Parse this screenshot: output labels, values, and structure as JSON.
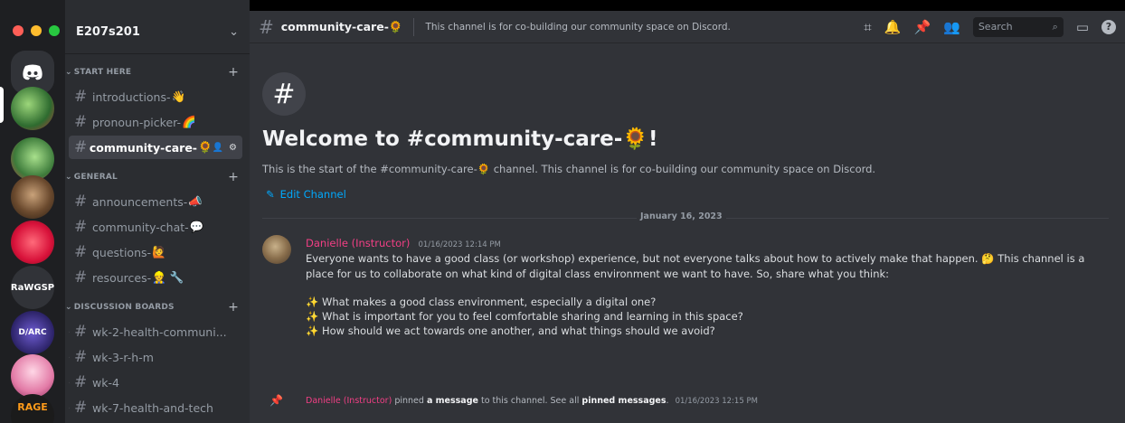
{
  "window": {
    "lights": [
      "#ff5f57",
      "#febc2e",
      "#28c840"
    ]
  },
  "servers": [
    {
      "name": "home",
      "icon": "discord-logo-icon"
    },
    {
      "name": "server-1",
      "label": ""
    },
    {
      "name": "server-2",
      "label": ""
    },
    {
      "name": "server-3",
      "label": ""
    },
    {
      "name": "server-4",
      "label": ""
    },
    {
      "name": "server-rawgsp",
      "label": "RaWGSP"
    },
    {
      "name": "server-diarc",
      "label": "D/ARC"
    },
    {
      "name": "server-6",
      "label": ""
    },
    {
      "name": "server-rage",
      "label": "RAGE"
    }
  ],
  "sidebar": {
    "server_name": "E207s201",
    "categories": [
      {
        "label": "START HERE",
        "channels": [
          {
            "name": "introductions-",
            "emoji": "👋"
          },
          {
            "name": "pronoun-picker-",
            "emoji": "🌈"
          },
          {
            "name": "community-care-",
            "emoji": "🌻",
            "active": true
          }
        ]
      },
      {
        "label": "GENERAL",
        "channels": [
          {
            "name": "announcements-",
            "emoji": "📣"
          },
          {
            "name": "community-chat-",
            "emoji": "💬"
          },
          {
            "name": "questions-",
            "emoji": "🙋"
          },
          {
            "name": "resources-",
            "emoji": "👷 🔧"
          }
        ]
      },
      {
        "label": "DISCUSSION BOARDS",
        "channels": [
          {
            "name": "wk-2-health-communi...",
            "emoji": ""
          },
          {
            "name": "wk-3-r-h-m",
            "emoji": ""
          },
          {
            "name": "wk-4",
            "emoji": ""
          },
          {
            "name": "wk-7-health-and-tech",
            "emoji": ""
          }
        ]
      }
    ]
  },
  "topbar": {
    "channel_name": "community-care-",
    "channel_emoji": "🌻",
    "topic": "This channel is for co-building our community space on Discord.",
    "search_placeholder": "Search"
  },
  "intro": {
    "title": "Welcome to #community-care-",
    "title_emoji": "🌻",
    "title_end": "!",
    "start_note_a": "This is the start of the #community-care-",
    "start_note_emoji": "🌻",
    "start_note_b": " channel. This channel is for co-building our community space on Discord.",
    "edit_label": "Edit Channel"
  },
  "divider_date": "January 16, 2023",
  "message": {
    "author": "Danielle (Instructor)",
    "timestamp": "01/16/2023 12:14 PM",
    "text_a": "Everyone wants to have a good class (or workshop) experience, but not everyone talks about how to actively make that happen. ",
    "text_emoji": "🤔",
    "text_b": " This channel is a place for us to collaborate on what kind of digital class environment we want to have. So, share what you think:",
    "points": [
      "What makes a good class environment, especially a digital one?",
      "What is important for you to feel comfortable sharing and learning in this space?",
      "How should we act towards one another, and what things should we avoid?"
    ],
    "point_emoji": "✨"
  },
  "pin_notice": {
    "author": "Danielle (Instructor)",
    "t1": " pinned ",
    "link1": "a message",
    "t2": " to this channel. See all ",
    "link2": "pinned messages",
    "t3": ".",
    "timestamp": "01/16/2023 12:15 PM"
  }
}
